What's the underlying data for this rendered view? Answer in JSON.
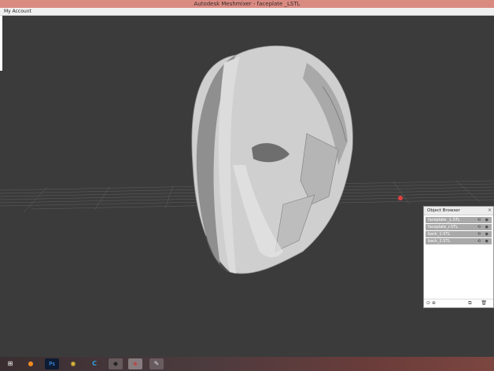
{
  "window": {
    "title": "Autodesk Meshmixer - faceplate _LSTL"
  },
  "menubar": {
    "account_label": "My Account"
  },
  "object_browser": {
    "title": "Object Browser",
    "close_glyph": "×",
    "items": [
      {
        "label": "faceplate _L.STL"
      },
      {
        "label": "faceplate_r.STL"
      },
      {
        "label": "back_1.STL"
      },
      {
        "label": "back_2.STL"
      }
    ],
    "footer_left": "⊙ ⊕",
    "footer_right": "⧉ 🗑"
  },
  "taskbar": {
    "apps": [
      {
        "icon": "windows-start-icon",
        "glyph": "⊞"
      },
      {
        "icon": "firefox-icon",
        "glyph": "●"
      },
      {
        "icon": "photoshop-icon",
        "glyph": "Ps"
      },
      {
        "icon": "chrome-icon",
        "glyph": "◉"
      },
      {
        "icon": "cura-icon",
        "glyph": "C"
      },
      {
        "icon": "app-icon-1",
        "glyph": "◆"
      },
      {
        "icon": "meshmixer-icon",
        "glyph": "◈"
      },
      {
        "icon": "app-icon-3",
        "glyph": "✎"
      }
    ]
  },
  "colors": {
    "titlebar": "#d98b82",
    "viewport_bg": "#3b3b3b",
    "mesh_light": "#d8d8d8",
    "mesh_shadow": "#7a7a7a",
    "pivot_marker": "#e04040"
  }
}
